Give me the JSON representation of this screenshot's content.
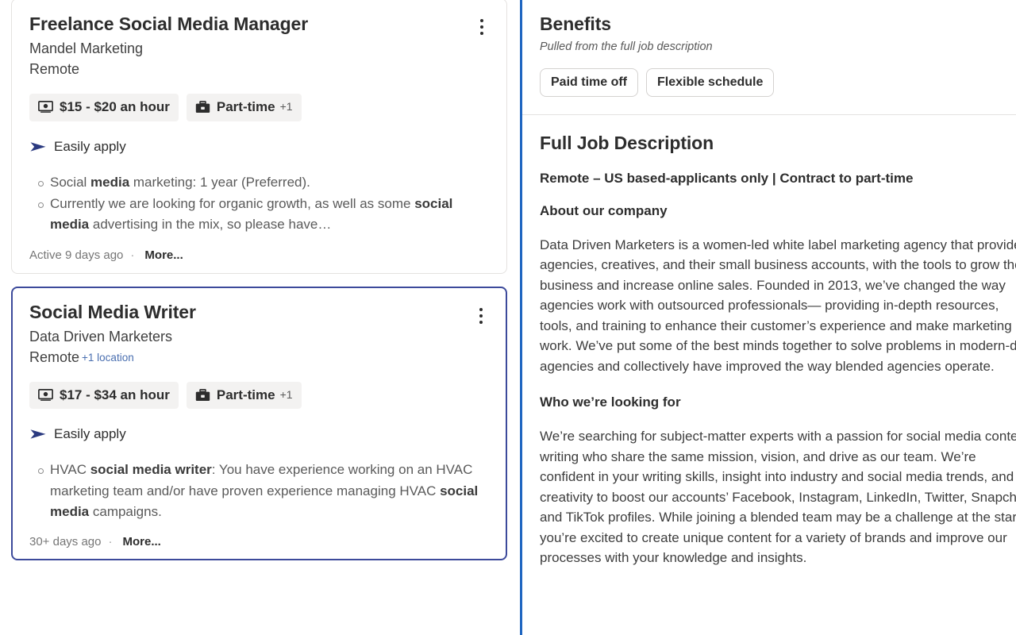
{
  "left_panel": {
    "jobs": [
      {
        "title": "Freelance Social Media Manager",
        "company": "Mandel Marketing",
        "location": "Remote",
        "location_extra": "",
        "selected": false,
        "salary_chip": "$15 - $20 an hour",
        "salary_icon": "money-bill-icon",
        "jobtype_chip": "Part-time",
        "jobtype_plus": "+1",
        "jobtype_icon": "briefcase-icon",
        "easily_apply_label": "Easily apply",
        "easily_apply_icon": "send-arrow-icon",
        "snippets": [
          {
            "pre": "Social ",
            "bold": "media",
            "post": " marketing: 1 year (Preferred)."
          },
          {
            "pre": "Currently we are looking for organic growth, as well as some ",
            "bold": "social media",
            "post": " advertising in the mix, so please have…"
          }
        ],
        "activity": "Active 9 days ago",
        "separator": "·",
        "more_label": "More..."
      },
      {
        "title": "Social Media Writer",
        "company": "Data Driven Marketers",
        "location": "Remote",
        "location_extra": "+1 location",
        "selected": true,
        "salary_chip": "$17 - $34 an hour",
        "salary_icon": "money-bill-icon",
        "jobtype_chip": "Part-time",
        "jobtype_plus": "+1",
        "jobtype_icon": "briefcase-icon",
        "easily_apply_label": "Easily apply",
        "easily_apply_icon": "send-arrow-icon",
        "snippets": [
          {
            "pre": "HVAC ",
            "bold": "social media writer",
            "post": ": You have experience working on an HVAC marketing team and/or have proven experience managing HVAC ",
            "bold2": "social media",
            "post2": " campaigns."
          }
        ],
        "activity": "30+ days ago",
        "separator": "·",
        "more_label": "More..."
      }
    ]
  },
  "right_panel": {
    "benefits": {
      "title": "Benefits",
      "subtitle": "Pulled from the full job description",
      "chips": [
        "Paid time off",
        "Flexible schedule"
      ]
    },
    "description": {
      "title": "Full Job Description",
      "heading_1": "Remote – US based-applicants only | Contract to part-time",
      "heading_2": "About our company",
      "paragraph_1": "Data Driven Marketers is a women-led white label marketing agency that provides agencies, creatives, and their small business accounts, with the tools to grow their business and increase online sales. Founded in 2013, we’ve changed the way agencies work with outsourced professionals— providing in-depth resources, tools, and training to enhance their customer’s experience and make marketing work. We’ve put some of the best minds together to solve problems in modern-day agencies and collectively have improved the way blended agencies operate.",
      "heading_3": "Who we’re looking for",
      "paragraph_2": "We’re searching for subject-matter experts with a passion for social media content writing who share the same mission, vision, and drive as our team. We’re confident in your writing skills, insight into industry and social media trends, and creativity to boost our accounts’ Facebook, Instagram, LinkedIn, Twitter, Snapchat, and TikTok profiles. While joining a blended team may be a challenge at the start, you’re excited to create unique content for a variety of brands and improve our processes with your knowledge and insights."
    }
  },
  "colors": {
    "selected_card_border": "#3c4a9b",
    "pane_divider": "#1f66c1",
    "link_blue": "#4a6fb0",
    "easily_apply_arrow": "#2b3a80",
    "chip_bg": "#f3f2f1"
  }
}
